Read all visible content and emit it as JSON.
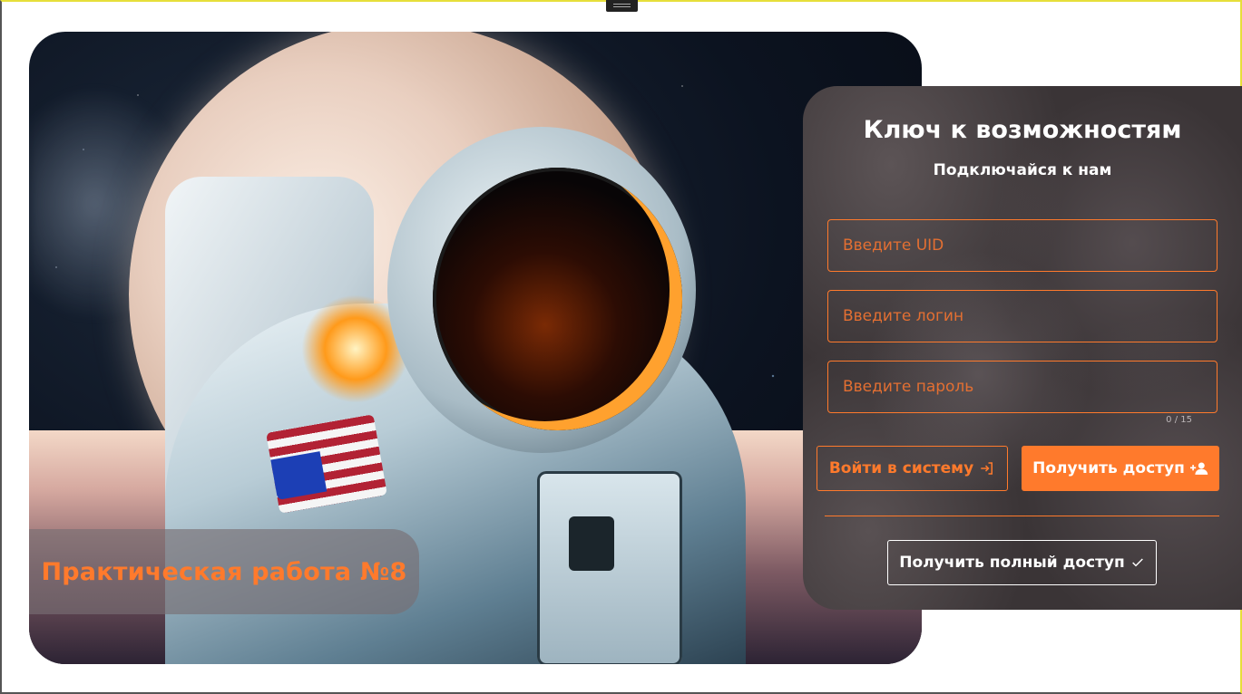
{
  "hero": {
    "caption": "Практическая работа №8"
  },
  "login_card": {
    "title": "Ключ к возможностям",
    "subtitle": "Подключайся к нам",
    "uid_placeholder": "Введите UID",
    "login_placeholder": "Введите логин",
    "password_placeholder": "Введите пароль",
    "password_counter": "0 / 15",
    "login_button": "Войти в систему",
    "login_button_icon": "login-icon",
    "register_button": "Получить доступ",
    "register_button_icon": "person-add-icon",
    "full_access_button": "Получить полный доступ",
    "full_access_button_icon": "check-icon"
  },
  "colors": {
    "accent": "#ff7a2c",
    "card_background": "#3a3436",
    "text_light": "#ffffff"
  }
}
